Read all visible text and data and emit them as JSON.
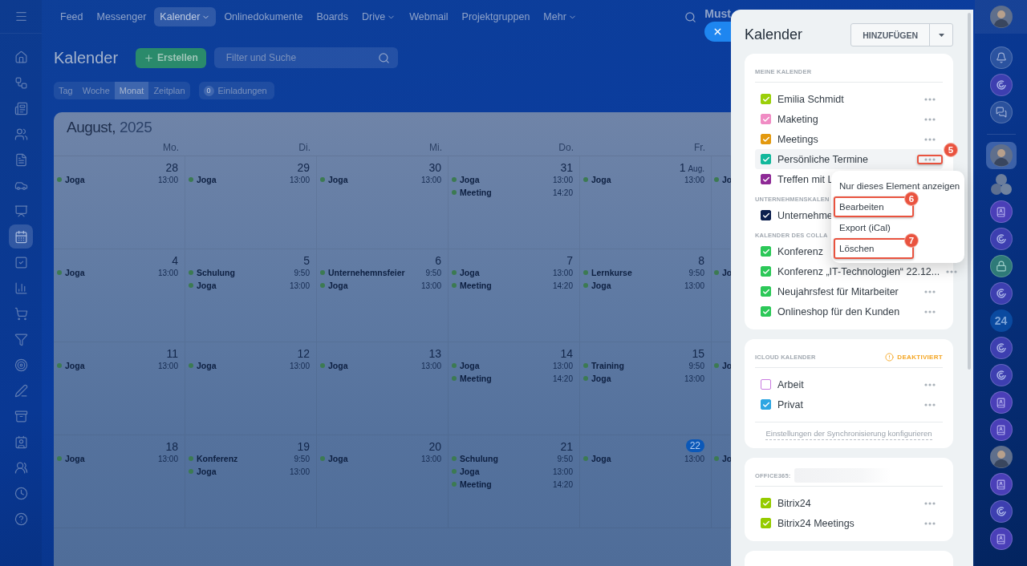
{
  "left_nav": [
    {
      "kind": "menu",
      "selected": false
    },
    {
      "kind": "home",
      "selected": false
    },
    {
      "kind": "workflow",
      "selected": false
    },
    {
      "kind": "newspaper",
      "selected": false
    },
    {
      "kind": "users",
      "selected": false
    },
    {
      "kind": "file",
      "selected": false
    },
    {
      "kind": "car",
      "selected": false
    },
    {
      "kind": "presentation",
      "selected": false
    },
    {
      "kind": "calendar",
      "selected": true
    },
    {
      "kind": "tasks",
      "selected": false
    },
    {
      "kind": "chart",
      "selected": false
    },
    {
      "kind": "cart",
      "selected": false
    },
    {
      "kind": "filter",
      "selected": false
    },
    {
      "kind": "target",
      "selected": false
    },
    {
      "kind": "pen",
      "selected": false
    },
    {
      "kind": "archive",
      "selected": false
    },
    {
      "kind": "contact",
      "selected": false
    },
    {
      "kind": "group",
      "selected": false
    },
    {
      "kind": "clock",
      "selected": false
    },
    {
      "kind": "help",
      "selected": false
    }
  ],
  "top_nav": {
    "items": [
      {
        "label": "Feed",
        "selected": false,
        "caret": false
      },
      {
        "label": "Messenger",
        "selected": false,
        "caret": false
      },
      {
        "label": "Kalender",
        "selected": true,
        "caret": true
      },
      {
        "label": "Onlinedokumente",
        "selected": false,
        "caret": false
      },
      {
        "label": "Boards",
        "selected": false,
        "caret": false
      },
      {
        "label": "Drive",
        "selected": false,
        "caret": true
      },
      {
        "label": "Webmail",
        "selected": false,
        "caret": false
      },
      {
        "label": "Projektgruppen",
        "selected": false,
        "caret": false
      },
      {
        "label": "Mehr",
        "selected": false,
        "caret": true
      }
    ],
    "user_name": "Must"
  },
  "page": {
    "title": "Kalender",
    "create_button": "Erstellen",
    "search": {
      "placeholder": "Filter und Suche"
    },
    "views": [
      {
        "label": "Tag",
        "selected": false
      },
      {
        "label": "Woche",
        "selected": false
      },
      {
        "label": "Monat",
        "selected": true
      },
      {
        "label": "Zeitplan",
        "selected": false
      }
    ],
    "invitations": {
      "count": "0",
      "label": "Einladungen"
    }
  },
  "calendar": {
    "month": "August,",
    "year": "2025",
    "weekdays": [
      "Mo.",
      "Di.",
      "Mi.",
      "Do.",
      "Fr."
    ],
    "weeks": [
      [
        {
          "day": "28",
          "today": false,
          "events": [
            {
              "title": "Joga",
              "time": "13:00"
            }
          ]
        },
        {
          "day": "29",
          "today": false,
          "events": [
            {
              "title": "Joga",
              "time": "13:00"
            }
          ]
        },
        {
          "day": "30",
          "today": false,
          "events": [
            {
              "title": "Joga",
              "time": "13:00"
            }
          ]
        },
        {
          "day": "31",
          "today": false,
          "events": [
            {
              "title": "Joga",
              "time": "13:00"
            },
            {
              "title": "Meeting",
              "time": "14:20"
            }
          ]
        },
        {
          "day": "1",
          "month": "Aug.",
          "today": false,
          "events": [
            {
              "title": "Joga",
              "time": "13:00"
            }
          ]
        },
        {
          "events": [
            {
              "title": "Jo"
            }
          ]
        }
      ],
      [
        {
          "day": "4",
          "today": false,
          "events": [
            {
              "title": "Joga",
              "time": "13:00"
            }
          ]
        },
        {
          "day": "5",
          "today": false,
          "events": [
            {
              "title": "Schulung",
              "time": "9:50"
            },
            {
              "title": "Joga",
              "time": "13:00"
            }
          ]
        },
        {
          "day": "6",
          "today": false,
          "events": [
            {
              "title": "Unternehemnsfeier",
              "time": "9:50"
            },
            {
              "title": "Joga",
              "time": "13:00"
            }
          ]
        },
        {
          "day": "7",
          "today": false,
          "events": [
            {
              "title": "Joga",
              "time": "13:00"
            },
            {
              "title": "Meeting",
              "time": "14:20"
            }
          ]
        },
        {
          "day": "8",
          "today": false,
          "events": [
            {
              "title": "Lernkurse",
              "time": "9:50"
            },
            {
              "title": "Joga",
              "time": "13:00"
            }
          ]
        },
        {
          "events": [
            {
              "title": "Jo"
            }
          ]
        }
      ],
      [
        {
          "day": "11",
          "today": false,
          "events": [
            {
              "title": "Joga",
              "time": "13:00"
            }
          ]
        },
        {
          "day": "12",
          "today": false,
          "events": [
            {
              "title": "Joga",
              "time": "13:00"
            }
          ]
        },
        {
          "day": "13",
          "today": false,
          "events": [
            {
              "title": "Joga",
              "time": "13:00"
            }
          ]
        },
        {
          "day": "14",
          "today": false,
          "events": [
            {
              "title": "Joga",
              "time": "13:00"
            },
            {
              "title": "Meeting",
              "time": "14:20"
            }
          ]
        },
        {
          "day": "15",
          "today": false,
          "events": [
            {
              "title": "Training",
              "time": "9:50"
            },
            {
              "title": "Joga",
              "time": "13:00"
            }
          ]
        },
        {
          "events": [
            {
              "title": "Jo"
            }
          ]
        }
      ],
      [
        {
          "day": "18",
          "today": false,
          "events": [
            {
              "title": "Joga",
              "time": "13:00"
            }
          ]
        },
        {
          "day": "19",
          "today": false,
          "events": [
            {
              "title": "Konferenz",
              "time": "9:50"
            },
            {
              "title": "Joga",
              "time": "13:00"
            }
          ]
        },
        {
          "day": "20",
          "today": false,
          "events": [
            {
              "title": "Joga",
              "time": "13:00"
            }
          ]
        },
        {
          "day": "21",
          "today": false,
          "events": [
            {
              "title": "Schulung",
              "time": "9:50"
            },
            {
              "title": "Joga",
              "time": "13:00"
            },
            {
              "title": "Meeting",
              "time": "14:20"
            }
          ]
        },
        {
          "day": "22",
          "today": true,
          "events": [
            {
              "title": "Joga",
              "time": "13:00"
            }
          ]
        },
        {
          "events": [
            {
              "title": "Jo"
            }
          ]
        }
      ]
    ]
  },
  "panel": {
    "title": "Kalender",
    "add_button": "HINZUFÜGEN",
    "cards": [
      {
        "kind": "list",
        "groups": [
          {
            "title": "MEINE KALENDER",
            "items": [
              {
                "name": "Emilia Schmidt",
                "color": "#9bcf0a",
                "checked": true,
                "highlighted": false,
                "actions": true
              },
              {
                "name": "Maketing",
                "color": "#f08cc4",
                "checked": true,
                "highlighted": false,
                "actions": true
              },
              {
                "name": "Meetings",
                "color": "#e3990f",
                "checked": true,
                "highlighted": false,
                "actions": true
              },
              {
                "name": "Persönliche Termine",
                "color": "#12b89c",
                "checked": true,
                "highlighted": true,
                "actions": true,
                "callout": "5"
              },
              {
                "name": "Treffen mit L",
                "color": "#8e2a96",
                "checked": true,
                "highlighted": false,
                "actions": false
              }
            ]
          },
          {
            "title": "UNTERNEHMENSKALEN",
            "items": [
              {
                "name": "Unternehme",
                "color": "#0b1f4e",
                "checked": true,
                "highlighted": false,
                "actions": false
              }
            ]
          },
          {
            "title": "KALENDER DES COLLA",
            "items": [
              {
                "name": "Konferenz",
                "color": "#2cc858",
                "checked": true,
                "highlighted": false,
                "actions": false
              },
              {
                "name": "Konferenz „IT-Technologien“ 22.12...",
                "color": "#2cc858",
                "checked": true,
                "highlighted": false,
                "actions": true
              },
              {
                "name": "Neujahrsfest für Mitarbeiter",
                "color": "#2cc858",
                "checked": true,
                "highlighted": false,
                "actions": true
              },
              {
                "name": "Onlineshop für den Kunden",
                "color": "#2cc858",
                "checked": true,
                "highlighted": false,
                "actions": true
              }
            ]
          }
        ]
      },
      {
        "kind": "list",
        "footer_link": "Einstellungen der Synchronisierung konfigurieren",
        "groups": [
          {
            "title": "ICLOUD KALENDER",
            "status": "DEAKTIVIERT",
            "items": [
              {
                "name": "Arbeit",
                "color": "#c97ae0",
                "checked": false,
                "highlighted": false,
                "actions": true
              },
              {
                "name": "Privat",
                "color": "#2ea6e2",
                "checked": true,
                "highlighted": false,
                "actions": true
              }
            ]
          }
        ]
      },
      {
        "kind": "list",
        "groups": [
          {
            "title": "OFFICE365:",
            "redacted": true,
            "items": [
              {
                "name": "Bitrix24",
                "color": "#95cb00",
                "checked": true,
                "highlighted": false,
                "actions": true
              },
              {
                "name": "Bitrix24 Meetings",
                "color": "#95cb00",
                "checked": true,
                "highlighted": false,
                "actions": true
              }
            ]
          }
        ]
      },
      {
        "kind": "empty"
      }
    ]
  },
  "context_menu": {
    "items": [
      {
        "label": "Nur dieses Element anzeigen"
      },
      {
        "label": "Bearbeiten",
        "callout": "6"
      },
      {
        "label": "Export (iCal)"
      },
      {
        "label": "Löschen",
        "callout": "7"
      }
    ]
  },
  "right_sidebar": [
    {
      "kind": "avatar",
      "selected": false
    },
    {
      "kind": "bell",
      "selected": false
    },
    {
      "kind": "spiral",
      "selected": false
    },
    {
      "kind": "chat",
      "selected": false
    },
    {
      "kind": "divider"
    },
    {
      "kind": "avatar",
      "selected": true
    },
    {
      "kind": "group",
      "selected": false
    },
    {
      "kind": "book",
      "selected": false
    },
    {
      "kind": "spiral",
      "selected": false
    },
    {
      "kind": "lock",
      "selected": false
    },
    {
      "kind": "spiral",
      "selected": false
    },
    {
      "kind": "counter",
      "label": "24",
      "selected": false
    },
    {
      "kind": "spiral",
      "selected": false
    },
    {
      "kind": "spiral",
      "selected": false
    },
    {
      "kind": "book",
      "selected": false
    },
    {
      "kind": "book",
      "selected": false
    },
    {
      "kind": "avatar",
      "selected": false
    },
    {
      "kind": "book",
      "selected": false
    },
    {
      "kind": "spiral",
      "selected": false
    },
    {
      "kind": "book",
      "selected": false
    }
  ]
}
